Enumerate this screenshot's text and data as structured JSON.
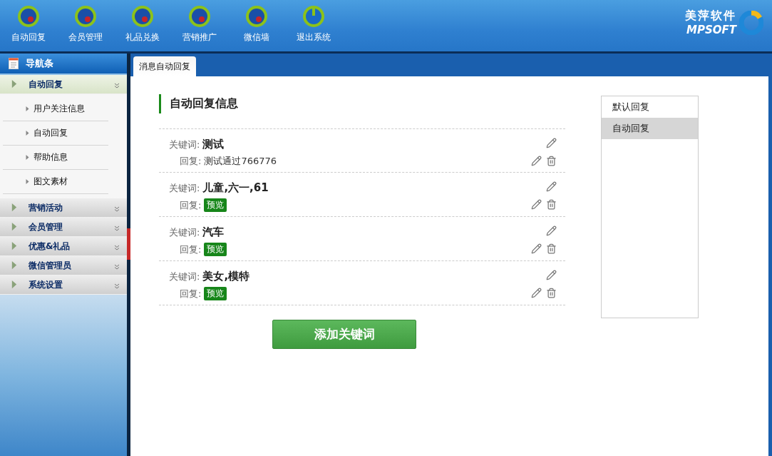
{
  "toolbar": [
    {
      "label": "自动回复",
      "kind": "reply"
    },
    {
      "label": "会员管理",
      "kind": "member"
    },
    {
      "label": "礼品兑换",
      "kind": "gift"
    },
    {
      "label": "营销推广",
      "kind": "money"
    },
    {
      "label": "微信墙",
      "kind": "wall"
    },
    {
      "label": "退出系统",
      "kind": "power"
    }
  ],
  "logo": {
    "name": "美萍软件",
    "brand": "MPSOFT"
  },
  "sidebar": {
    "title": "导航条",
    "groups": [
      {
        "label": "自动回复",
        "expanded": true,
        "children": [
          {
            "label": "用户关注信息"
          },
          {
            "label": "自动回复"
          },
          {
            "label": "帮助信息"
          },
          {
            "label": "图文素材"
          }
        ]
      },
      {
        "label": "营销活动",
        "expanded": false
      },
      {
        "label": "会员管理",
        "expanded": false
      },
      {
        "label": "优惠&礼品",
        "expanded": false
      },
      {
        "label": "微信管理员",
        "expanded": false
      },
      {
        "label": "系统设置",
        "expanded": false
      }
    ]
  },
  "tabs": [
    {
      "label": "消息自动回复",
      "selected": true
    }
  ],
  "heading": "自动回复信息",
  "keywords": [
    {
      "label": "关键词:",
      "keyword": "测试",
      "reply_label": "回复:",
      "reply": {
        "kind": "text",
        "text": "测试通过766776"
      }
    },
    {
      "label": "关键词:",
      "keyword": "儿童,六一,61",
      "reply_label": "回复:",
      "reply": {
        "kind": "preview",
        "text": "预览"
      }
    },
    {
      "label": "关键词:",
      "keyword": "汽车",
      "reply_label": "回复:",
      "reply": {
        "kind": "preview",
        "text": "预览"
      }
    },
    {
      "label": "关键词:",
      "keyword": "美女,模特",
      "reply_label": "回复:",
      "reply": {
        "kind": "preview",
        "text": "预览"
      }
    }
  ],
  "add_button": "添加关键词",
  "reply_types": [
    {
      "label": "默认回复",
      "selected": false
    },
    {
      "label": "自动回复",
      "selected": true
    }
  ]
}
